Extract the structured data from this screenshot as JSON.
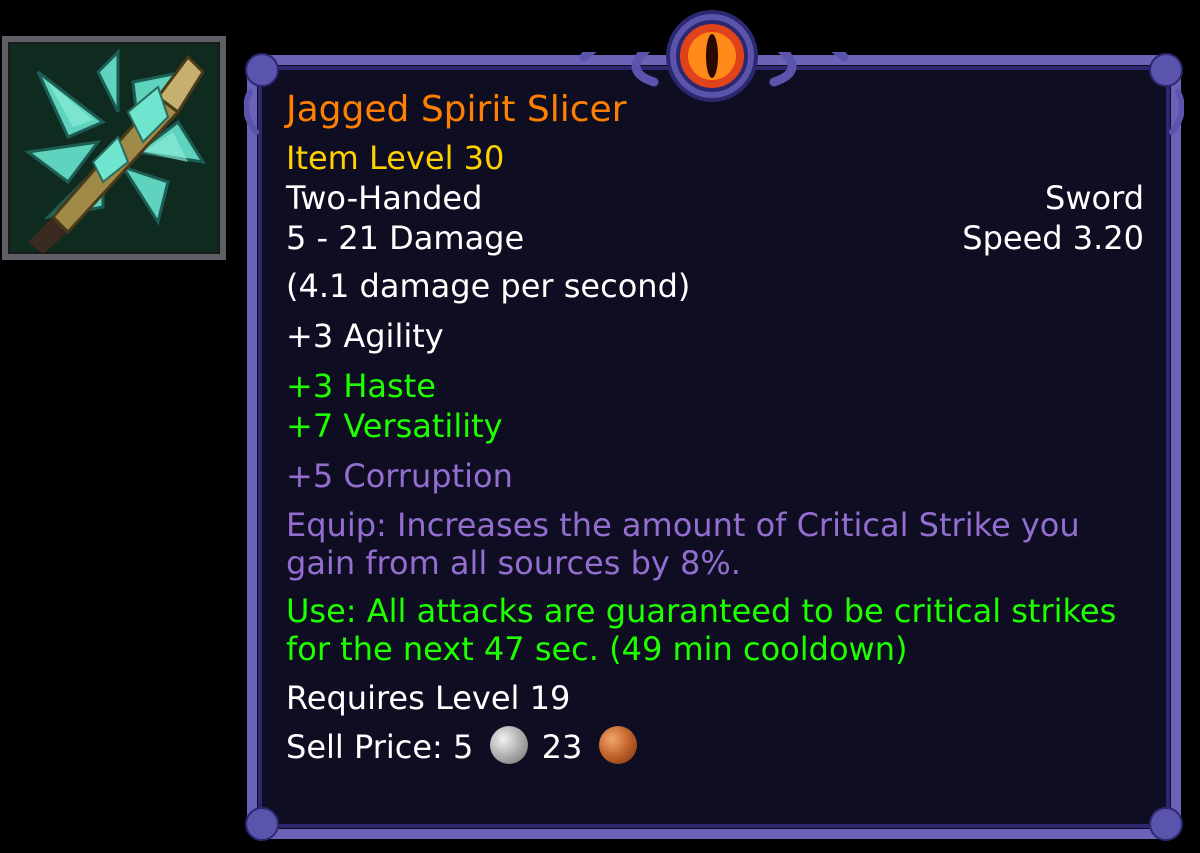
{
  "item": {
    "icon": "two-handed-sword-icon",
    "name": "Jagged Spirit Slicer",
    "item_level": "Item Level 30",
    "slot": "Two-Handed",
    "type": "Sword",
    "damage": "5 - 21 Damage",
    "speed": "Speed 3.20",
    "dps": "(4.1 damage per second)",
    "stats_white": [
      "+3 Agility"
    ],
    "stats_green": [
      "+3 Haste",
      "+7 Versatility"
    ],
    "corruption": "+5 Corruption",
    "equip_effect": "Equip: Increases the amount of Critical Strike you gain from all sources by 8%.",
    "use_effect": "Use: All attacks are guaranteed to be critical strikes for the next 47 sec. (49 min cooldown)",
    "requires_level": "Requires Level 19",
    "sell_price": {
      "label": "Sell Price:",
      "silver": "5",
      "copper": "23",
      "silver_icon": "silver-coin-icon",
      "copper_icon": "copper-coin-icon"
    }
  },
  "colors": {
    "legendary_orange": "#ff8000",
    "item_level_yellow": "#ffd100",
    "stat_green": "#1eff00",
    "corruption_purple": "#946dd1",
    "text_white": "#ffffff",
    "tooltip_bg": "#0e0d22",
    "border_purple": "#6a63b8"
  }
}
